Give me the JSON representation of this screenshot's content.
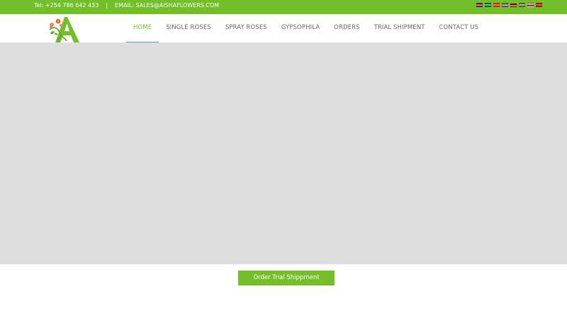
{
  "topbar": {
    "phone": "Tel: +254 786 642 433",
    "separator": "|",
    "email": "EMAIL: SALES@AISHAFLOWERS.COM",
    "background": "#73bf2a",
    "languages": [
      {
        "icon": "flag-uk-icon",
        "stripes": [
          "#012169",
          "#ffffff",
          "#c8102e"
        ]
      },
      {
        "icon": "flag-saudi-icon",
        "stripes": [
          "#006c35",
          "#ffffff",
          "#006c35"
        ]
      },
      {
        "icon": "flag-china-icon",
        "stripes": [
          "#de2910",
          "#ffde00",
          "#de2910"
        ]
      },
      {
        "icon": "flag-france-icon",
        "stripes": [
          "#0055a4",
          "#ffffff",
          "#ef4135"
        ]
      },
      {
        "icon": "flag-germany-icon",
        "stripes": [
          "#000000",
          "#dd0000",
          "#ffce00"
        ]
      },
      {
        "icon": "flag-italy-icon",
        "stripes": [
          "#009246",
          "#ffffff",
          "#ce2b37"
        ]
      },
      {
        "icon": "flag-russia-icon",
        "stripes": [
          "#ffffff",
          "#0039a6",
          "#d52b1e"
        ]
      },
      {
        "icon": "flag-spain-icon",
        "stripes": [
          "#aa151b",
          "#f1bf00",
          "#aa151b"
        ]
      }
    ]
  },
  "header": {
    "logo": "aisha-flowers-logo",
    "nav": [
      {
        "name": "nav-home",
        "label": "HOME",
        "active": true
      },
      {
        "name": "nav-single-roses",
        "label": "SINGLE ROSES",
        "active": false
      },
      {
        "name": "nav-spray-roses",
        "label": "SPRAY ROSES",
        "active": false
      },
      {
        "name": "nav-gypsophila",
        "label": "GYPSOPHILA",
        "active": false
      },
      {
        "name": "nav-orders",
        "label": "ORDERS",
        "active": false
      },
      {
        "name": "nav-trial-shipment",
        "label": "TRIAL SHIPMENT",
        "active": false
      },
      {
        "name": "nav-contact-us",
        "label": "CONTACT US",
        "active": false
      }
    ]
  },
  "hero": {
    "background": "#dedede"
  },
  "cta": {
    "label": "Order Trial Shippment"
  },
  "colors": {
    "accent": "#73bf2a",
    "nav_text": "#666666",
    "active_underline": "#3aa6c4"
  }
}
